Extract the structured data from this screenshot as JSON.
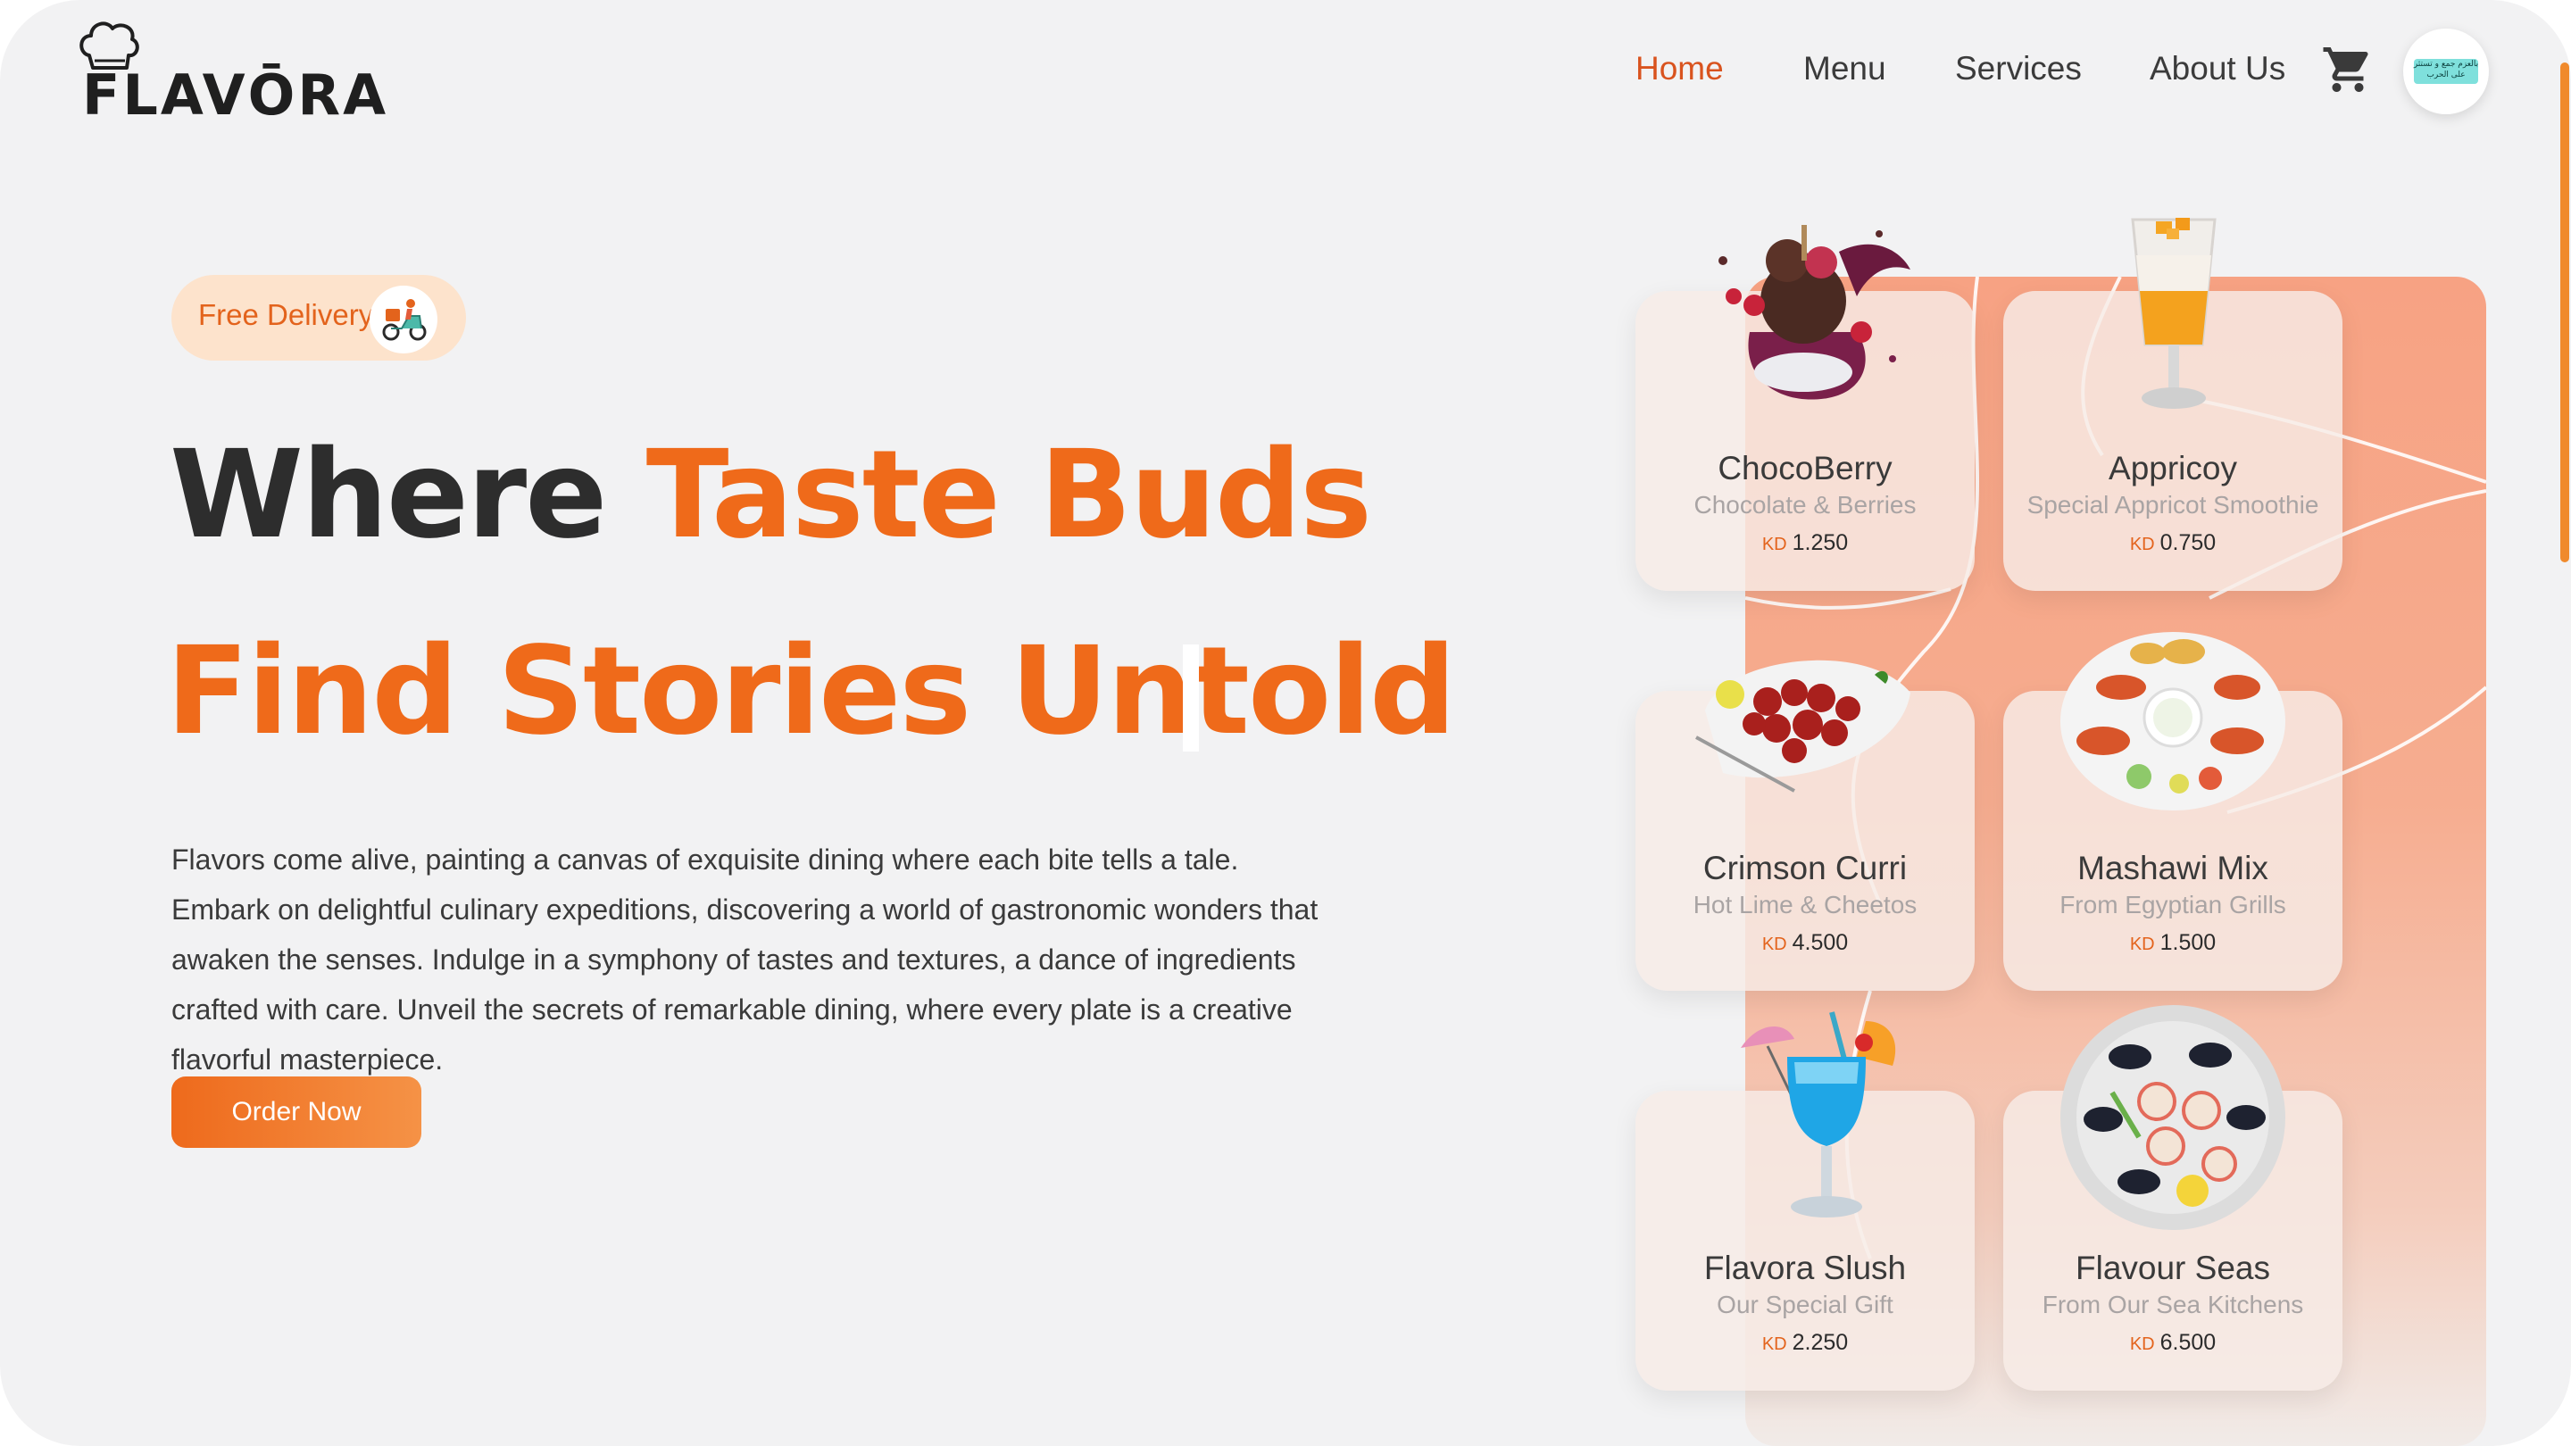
{
  "brand": {
    "name": "FLAVŌRA"
  },
  "nav": {
    "items": [
      {
        "label": "Home",
        "active": true
      },
      {
        "label": "Menu",
        "active": false
      },
      {
        "label": "Services",
        "active": false
      },
      {
        "label": "About Us",
        "active": false
      }
    ],
    "cart_icon": "shopping-cart-icon",
    "avatar_text": "بالعزم جمع و تستثر على الحرب"
  },
  "hero": {
    "badge_label": "Free Delivery",
    "headline_line1_plain": "Where ",
    "headline_line1_accent": "Taste Buds",
    "headline_line2": "Find Stories Untold",
    "body": "Flavors come alive, painting a canvas of exquisite dining where each bite tells a tale. Embark on delightful culinary expeditions, discovering a world of gastronomic wonders that awaken the senses. Indulge in a symphony of tastes and textures, a dance of ingredients crafted with care. Unveil the secrets of remarkable dining, where every plate is a creative flavorful masterpiece.",
    "cta_label": "Order Now"
  },
  "colors": {
    "accent": "#ef6a1a",
    "active_nav": "#d9531e",
    "text_dark": "#2d2d2d",
    "panel": "#f7a283"
  },
  "menu": {
    "currency": "KD",
    "cards": [
      {
        "name": "ChocoBerry",
        "subtitle": "Chocolate & Berries",
        "price": "1.250",
        "image": "chocolate-berry-dessert-image"
      },
      {
        "name": "Appricoy",
        "subtitle": "Special Appricot Smoothie",
        "price": "0.750",
        "image": "apricot-smoothie-image"
      },
      {
        "name": "Crimson Curri",
        "subtitle": "Hot Lime & Cheetos",
        "price": "4.500",
        "image": "crimson-curry-chicken-image"
      },
      {
        "name": "Mashawi Mix",
        "subtitle": "From Egyptian Grills",
        "price": "1.500",
        "image": "mixed-grill-platter-image"
      },
      {
        "name": "Flavora Slush",
        "subtitle": "Our Special Gift",
        "price": "2.250",
        "image": "blue-slush-cocktail-image"
      },
      {
        "name": "Flavour Seas",
        "subtitle": "From Our Sea Kitchens",
        "price": "6.500",
        "image": "seafood-platter-image"
      }
    ]
  }
}
